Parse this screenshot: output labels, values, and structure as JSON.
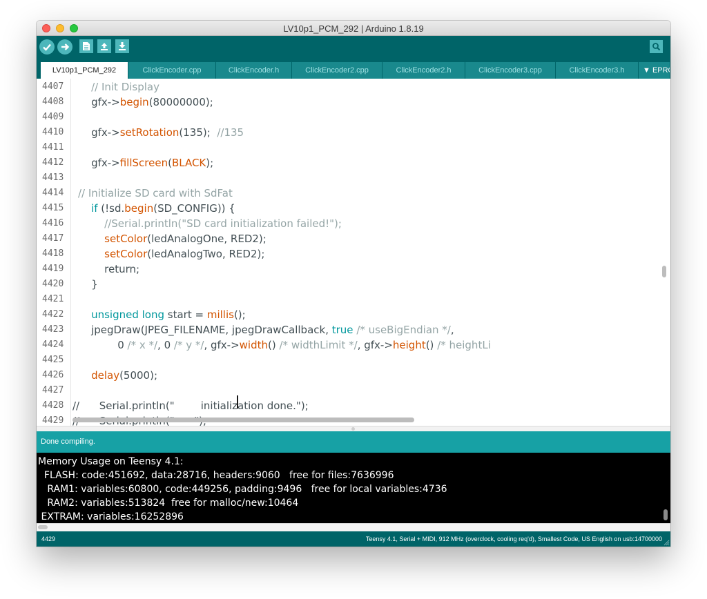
{
  "window": {
    "title": "LV10p1_PCM_292 | Arduino 1.8.19"
  },
  "toolbar": {
    "verify": "verify-icon",
    "upload": "upload-icon",
    "new": "new-file-icon",
    "open": "open-icon",
    "save": "save-icon",
    "serial_monitor": "serial-monitor-icon"
  },
  "tabs": [
    {
      "label": "LV10p1_PCM_292",
      "active": true
    },
    {
      "label": "ClickEncoder.cpp"
    },
    {
      "label": "ClickEncoder.h"
    },
    {
      "label": "ClickEncoder2.cpp"
    },
    {
      "label": "ClickEncoder2.h"
    },
    {
      "label": "ClickEncoder3.cpp"
    },
    {
      "label": "ClickEncoder3.h"
    },
    {
      "label": "▼ EPRO"
    }
  ],
  "editor": {
    "line_numbers": [
      "4407",
      "4408",
      "4409",
      "4410",
      "4411",
      "4412",
      "4413",
      "4414",
      "4415",
      "4416",
      "4417",
      "4418",
      "4419",
      "4420",
      "4421",
      "4422",
      "4423",
      "4424",
      "4425",
      "4426",
      "4427",
      "4428",
      "4429"
    ],
    "code": {
      "l4407": "    // Init Display",
      "l4408": {
        "a": "    gfx->",
        "b": "begin",
        "c": "(80000000);"
      },
      "l4410": {
        "a": "    gfx->",
        "b": "setRotation",
        "c": "(135);  ",
        "d": "//135"
      },
      "l4412": {
        "a": "    gfx->",
        "b": "fillScreen",
        "c": "(",
        "d": "BLACK",
        "e": ");"
      },
      "l4414": "// Initialize SD card with SdFat",
      "l4415": {
        "a": "    ",
        "b": "if",
        "c": " (!sd.",
        "d": "begin",
        "e": "(SD_CONFIG)) {"
      },
      "l4416": "        //Serial.println(\"SD card initialization failed!\");",
      "l4417": {
        "a": "        ",
        "b": "setColor",
        "c": "(ledAnalogOne, RED2);"
      },
      "l4418": {
        "a": "        ",
        "b": "setColor",
        "c": "(ledAnalogTwo, RED2);"
      },
      "l4419": "        return;",
      "l4420": "    }",
      "l4422": {
        "a": "    ",
        "b": "unsigned",
        "c": " ",
        "d": "long",
        "e": " start = ",
        "f": "millis",
        "g": "();"
      },
      "l4423": {
        "a": "    jpegDraw(JPEG_FILENAME, jpegDrawCallback, ",
        "b": "true",
        "c": " ",
        "d": "/* useBigEndian */",
        "e": ","
      },
      "l4424": {
        "a": "            0 ",
        "b": "/* x */",
        "c": ", 0 ",
        "d": "/* y */",
        "e": ", gfx->",
        "f": "width",
        "g": "() ",
        "h": "/* widthLimit */",
        "i": ", gfx->",
        "j": "height",
        "k": "() ",
        "l": "/* heightLi"
      },
      "l4426": {
        "a": "    ",
        "b": "delay",
        "c": "(5000);"
      },
      "l4428": "//      Serial.println(\"        initialization done.\");",
      "l4429": "//      Serial.println(\"      \");"
    }
  },
  "status": {
    "message": "Done compiling."
  },
  "console": {
    "lines": [
      "Memory Usage on Teensy 4.1:",
      "  FLASH: code:451692, data:28716, headers:9060   free for files:7636996",
      "   RAM1: variables:60800, code:449256, padding:9496   free for local variables:4736",
      "   RAM2: variables:513824  free for malloc/new:10464",
      " EXTRAM: variables:16252896"
    ]
  },
  "footer": {
    "line": "4429",
    "board": "Teensy 4.1, Serial + MIDI, 912 MHz (overclock, cooling req'd), Smallest Code, US English on usb:14700000"
  },
  "colors": {
    "toolbar_bg": "#006468",
    "tab_bg": "#19898d",
    "status_bg": "#17a1a5",
    "keyword": "#00979c",
    "function": "#d35400",
    "comment": "#95a5a6"
  }
}
